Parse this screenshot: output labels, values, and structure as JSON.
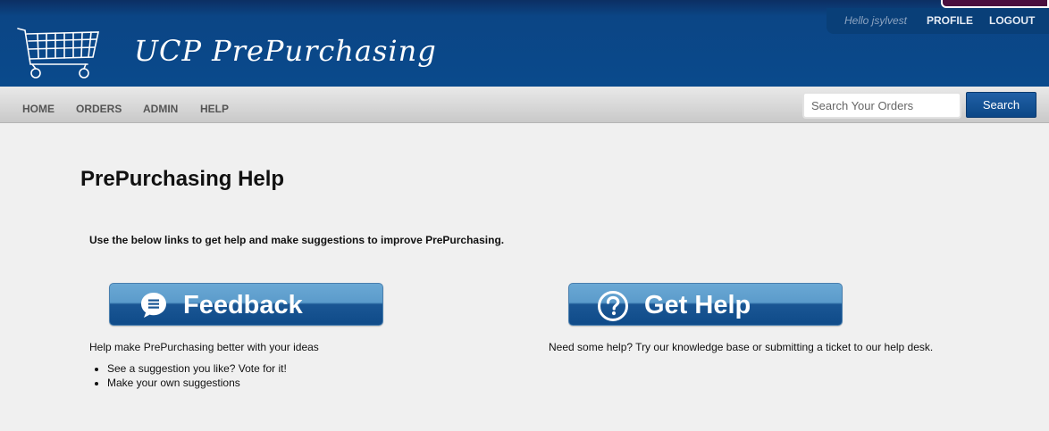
{
  "header": {
    "app_title": "UCP PrePurchasing",
    "greeting": "Hello jsylvest",
    "profile_label": "PROFILE",
    "logout_label": "LOGOUT"
  },
  "nav": {
    "items": [
      {
        "label": "HOME"
      },
      {
        "label": "ORDERS"
      },
      {
        "label": "ADMIN"
      },
      {
        "label": "HELP"
      }
    ],
    "search_placeholder": "Search Your Orders",
    "search_button": "Search"
  },
  "main": {
    "title": "PrePurchasing Help",
    "intro": "Use the below links to get help and make suggestions to improve PrePurchasing.",
    "feedback": {
      "button_label": "Feedback",
      "icon": "speech-bubble-icon",
      "description": "Help make PrePurchasing better with your ideas",
      "bullets": [
        "See a suggestion you like? Vote for it!",
        "Make your own suggestions"
      ]
    },
    "help": {
      "button_label": "Get Help",
      "icon": "question-circle-icon",
      "description": "Need some help? Try our knowledge base or submitting a ticket to our help desk."
    }
  },
  "colors": {
    "header_blue": "#0a4a8c",
    "button_blue": "#0e4a88",
    "accent_purple": "#4a0f3e"
  }
}
